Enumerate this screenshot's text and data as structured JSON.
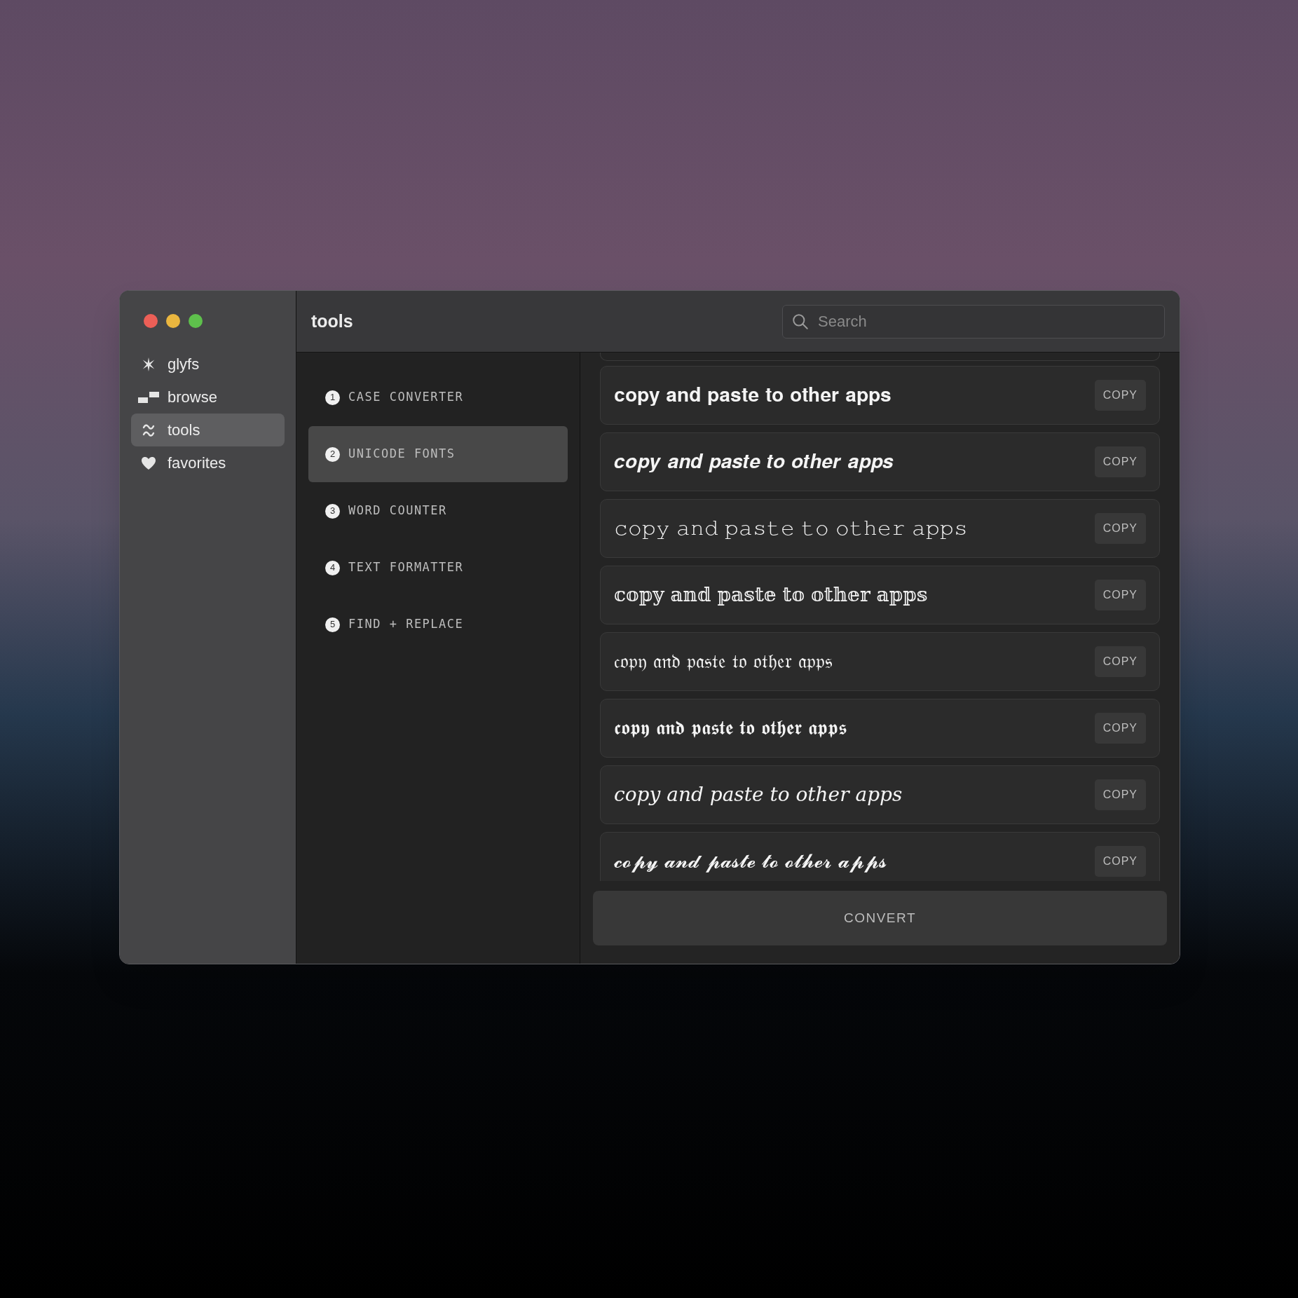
{
  "sidebar": {
    "items": [
      {
        "label": "glyfs",
        "kind": "sparkle",
        "selected": false
      },
      {
        "label": "browse",
        "kind": "blocks",
        "selected": false
      },
      {
        "label": "tools",
        "kind": "wave",
        "selected": true
      },
      {
        "label": "favorites",
        "kind": "heart",
        "selected": false
      }
    ]
  },
  "header": {
    "title": "tools",
    "search": {
      "placeholder": "Search"
    }
  },
  "tools": [
    {
      "number": "1",
      "label": "CASE CONVERTER",
      "selected": false
    },
    {
      "number": "2",
      "label": "UNICODE FONTS",
      "selected": true
    },
    {
      "number": "3",
      "label": "WORD COUNTER",
      "selected": false
    },
    {
      "number": "4",
      "label": "TEXT FORMATTER",
      "selected": false
    },
    {
      "number": "5",
      "label": "FIND + REPLACE",
      "selected": false
    }
  ],
  "results": [
    {
      "text": "𝐜𝐨𝐩𝐲 𝐚𝐧𝐝 𝐩𝐚𝐬𝐭𝐞 𝐭𝐨 𝐨𝐭𝐡𝐞𝐫 𝐚𝐩𝐩𝐬",
      "button": "COPY"
    },
    {
      "text": "𝒄𝒐𝒑𝒚 𝒂𝒏𝒅 𝒑𝒂𝒔𝒕𝒆 𝒕𝒐 𝒐𝒕𝒉𝒆𝒓 𝒂𝒑𝒑𝒔",
      "button": "COPY"
    },
    {
      "text": "𝚌𝚘𝚙𝚢 𝚊𝚗𝚍 𝚙𝚊𝚜𝚝𝚎 𝚝𝚘 𝚘𝚝𝚑𝚎𝚛 𝚊𝚙𝚙𝚜",
      "button": "COPY"
    },
    {
      "text": "𝕔𝕠𝕡𝕪 𝕒𝕟𝕕 𝕡𝕒𝕤𝕥𝕖 𝕥𝕠 𝕠𝕥𝕙𝕖𝕣 𝕒𝕡𝕡𝕤",
      "button": "COPY"
    },
    {
      "text": "𝔠𝔬𝔭𝔶 𝔞𝔫𝔡 𝔭𝔞𝔰𝔱𝔢 𝔱𝔬 𝔬𝔱𝔥𝔢𝔯 𝔞𝔭𝔭𝔰",
      "button": "COPY"
    },
    {
      "text": "𝖈𝖔𝖕𝖞 𝖆𝖓𝖉 𝖕𝖆𝖘𝖙𝖊 𝖙𝖔 𝖔𝖙𝖍𝖊𝖗 𝖆𝖕𝖕𝖘",
      "button": "COPY"
    },
    {
      "text": "𝑐𝑜𝑝𝑦 𝑎𝑛𝑑 𝑝𝑎𝑠𝑡𝑒 𝑡𝑜 𝑜𝑡ℎ𝑒𝑟 𝑎𝑝𝑝𝑠",
      "button": "COPY"
    },
    {
      "text": "𝓬𝓸𝓹𝔂 𝓪𝓷𝓭 𝓹𝓪𝓼𝓽𝓮 𝓽𝓸 𝓸𝓽𝓱𝓮𝓻 𝓪𝓹𝓹𝓼",
      "button": "COPY"
    }
  ],
  "convert_button": "CONVERT"
}
